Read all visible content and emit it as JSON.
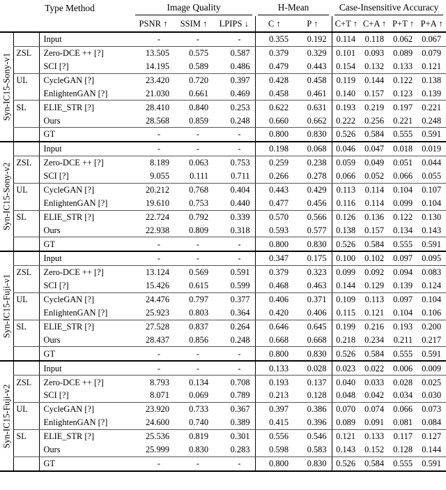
{
  "table": {
    "header": {
      "type_method": "Type Method",
      "groups": [
        {
          "label": "Image Quality",
          "span": 3
        },
        {
          "label": "H-Mean",
          "span": 2
        },
        {
          "label": "Case-Insensitive Accuracy",
          "span": 4
        }
      ],
      "columns": [
        "PSNR ↑",
        "SSIM ↑",
        "LPIPS ↓",
        "C ↑",
        "P ↑",
        "C+T ↑",
        "C+A ↑",
        "P+T ↑",
        "P+A ↑"
      ]
    },
    "blocks": [
      {
        "dataset": "Syn-IC15-Sony-v1",
        "rows": [
          {
            "type": "",
            "method": "Input",
            "bold": false,
            "values": [
              "-",
              "-",
              "-",
              "0.355",
              "0.192",
              "0.114",
              "0.118",
              "0.062",
              "0.067"
            ]
          },
          {
            "type": "ZSL",
            "method": "Zero-DCE ++ [?]",
            "bold": false,
            "values": [
              "13.505",
              "0.575",
              "0.587",
              "0.379",
              "0.329",
              "0.101",
              "0.093",
              "0.089",
              "0.079"
            ]
          },
          {
            "type": "",
            "method": "SCI [?]",
            "bold": false,
            "values": [
              "14.195",
              "0.589",
              "0.486",
              "0.479",
              "0.443",
              "0.154",
              "0.132",
              "0.133",
              "0.121"
            ]
          },
          {
            "type": "UL",
            "method": "CycleGAN [?]",
            "bold": false,
            "values": [
              "23.420",
              "0.720",
              "0.397",
              "0.428",
              "0.458",
              "0.119",
              "0.144",
              "0.122",
              "0.138"
            ]
          },
          {
            "type": "",
            "method": "EnlightenGAN [?]",
            "bold": false,
            "values": [
              "21.030",
              "0.661",
              "0.469",
              "0.458",
              "0.461",
              "0.140",
              "0.157",
              "0.123",
              "0.139"
            ]
          },
          {
            "type": "SL",
            "method": "ELIE_STR [?]",
            "bold": false,
            "values": [
              "28.410",
              "0.840",
              "0.253",
              "0.622",
              "0.631",
              "0.193",
              "0.219",
              "0.197",
              "0.221"
            ]
          },
          {
            "type": "",
            "method": "Ours",
            "bold": true,
            "values": [
              "28.568",
              "0.859",
              "0.248",
              "0.660",
              "0.662",
              "0.222",
              "0.256",
              "0.221",
              "0.248"
            ]
          },
          {
            "type": "",
            "method": "GT",
            "bold": false,
            "values": [
              "-",
              "-",
              "-",
              "0.800",
              "0.830",
              "0.526",
              "0.584",
              "0.555",
              "0.591"
            ]
          }
        ]
      },
      {
        "dataset": "Syn-IC15-Sony-v2",
        "rows": [
          {
            "type": "",
            "method": "Input",
            "bold": false,
            "values": [
              "-",
              "-",
              "-",
              "0.198",
              "0.068",
              "0.046",
              "0.047",
              "0.018",
              "0.019"
            ]
          },
          {
            "type": "ZSL",
            "method": "Zero-DCE ++ [?]",
            "bold": false,
            "values": [
              "8.189",
              "0.063",
              "0.753",
              "0.259",
              "0.238",
              "0.059",
              "0.049",
              "0.051",
              "0.044"
            ]
          },
          {
            "type": "",
            "method": "SCI [?]",
            "bold": false,
            "values": [
              "9.055",
              "0.111",
              "0.711",
              "0.266",
              "0.278",
              "0.066",
              "0.052",
              "0.066",
              "0.055"
            ]
          },
          {
            "type": "UL",
            "method": "CycleGAN [?]",
            "bold": false,
            "values": [
              "20.212",
              "0.768",
              "0.404",
              "0.443",
              "0.429",
              "0.113",
              "0.114",
              "0.104",
              "0.107"
            ]
          },
          {
            "type": "",
            "method": "EnlightenGAN [?]",
            "bold": false,
            "values": [
              "19.610",
              "0.753",
              "0.440",
              "0.477",
              "0.456",
              "0.116",
              "0.114",
              "0.099",
              "0.104"
            ]
          },
          {
            "type": "SL",
            "method": "ELIE_STR [?]",
            "bold": false,
            "values": [
              "22.724",
              "0.792",
              "0.339",
              "0.570",
              "0.566",
              "0.126",
              "0.136",
              "0.122",
              "0.130"
            ]
          },
          {
            "type": "",
            "method": "Ours",
            "bold": true,
            "values": [
              "22.938",
              "0.809",
              "0.318",
              "0.593",
              "0.577",
              "0.138",
              "0.157",
              "0.134",
              "0.143"
            ]
          },
          {
            "type": "",
            "method": "GT",
            "bold": false,
            "values": [
              "-",
              "-",
              "-",
              "0.800",
              "0.830",
              "0.526",
              "0.584",
              "0.555",
              "0.591"
            ]
          }
        ]
      },
      {
        "dataset": "Syn-IC15-Fuji-v1",
        "rows": [
          {
            "type": "",
            "method": "Input",
            "bold": false,
            "values": [
              "-",
              "-",
              "-",
              "0.347",
              "0.175",
              "0.100",
              "0.102",
              "0.097",
              "0.095"
            ]
          },
          {
            "type": "ZSL",
            "method": "Zero-DCE ++ [?]",
            "bold": false,
            "values": [
              "13.124",
              "0.569",
              "0.591",
              "0.379",
              "0.323",
              "0.099",
              "0.092",
              "0.094",
              "0.083"
            ]
          },
          {
            "type": "",
            "method": "SCI [?]",
            "bold": false,
            "values": [
              "15.426",
              "0.615",
              "0.599",
              "0.468",
              "0.463",
              "0.144",
              "0.129",
              "0.139",
              "0.124"
            ]
          },
          {
            "type": "UL",
            "method": "CycleGAN [?]",
            "bold": false,
            "values": [
              "24.476",
              "0.797",
              "0.377",
              "0.406",
              "0.371",
              "0.109",
              "0.113",
              "0.097",
              "0.104"
            ]
          },
          {
            "type": "",
            "method": "EnlightenGAN [?]",
            "bold": false,
            "values": [
              "25.923",
              "0.803",
              "0.364",
              "0.420",
              "0.406",
              "0.115",
              "0.121",
              "0.104",
              "0.106"
            ]
          },
          {
            "type": "SL",
            "method": "ELIE_STR [?]",
            "bold": false,
            "values": [
              "27.528",
              "0.837",
              "0.264",
              "0.646",
              "0.645",
              "0.199",
              "0.216",
              "0.193",
              "0.200"
            ]
          },
          {
            "type": "",
            "method": "Ours",
            "bold": true,
            "values": [
              "28.437",
              "0.856",
              "0.248",
              "0.668",
              "0.668",
              "0.218",
              "0.234",
              "0.211",
              "0.217"
            ]
          },
          {
            "type": "",
            "method": "GT",
            "bold": false,
            "values": [
              "-",
              "-",
              "-",
              "0.800",
              "0.830",
              "0.526",
              "0.584",
              "0.555",
              "0.591"
            ]
          }
        ]
      },
      {
        "dataset": "Syn-IC15-Fuji-v2",
        "rows": [
          {
            "type": "",
            "method": "Input",
            "bold": false,
            "values": [
              "-",
              "-",
              "-",
              "0.133",
              "0.028",
              "0.023",
              "0.022",
              "0.006",
              "0.009"
            ]
          },
          {
            "type": "ZSL",
            "method": "Zero-DCE ++ [?]",
            "bold": false,
            "values": [
              "8.793",
              "0.134",
              "0.708",
              "0.193",
              "0.137",
              "0.040",
              "0.033",
              "0.028",
              "0.025"
            ]
          },
          {
            "type": "",
            "method": "SCI [?]",
            "bold": false,
            "values": [
              "8.071",
              "0.069",
              "0.789",
              "0.213",
              "0.128",
              "0.048",
              "0.042",
              "0.034",
              "0.030"
            ]
          },
          {
            "type": "UL",
            "method": "CycleGAN [?]",
            "bold": false,
            "values": [
              "23.920",
              "0.733",
              "0.367",
              "0.397",
              "0.386",
              "0.070",
              "0.074",
              "0.066",
              "0.073"
            ]
          },
          {
            "type": "",
            "method": "EnlightenGAN [?]",
            "bold": false,
            "values": [
              "24.600",
              "0.740",
              "0.389",
              "0.415",
              "0.396",
              "0.089",
              "0.091",
              "0.081",
              "0.084"
            ]
          },
          {
            "type": "SL",
            "method": "ELIE_STR [?]",
            "bold": false,
            "values": [
              "25.536",
              "0.819",
              "0.301",
              "0.556",
              "0.546",
              "0.121",
              "0.133",
              "0.117",
              "0.127"
            ]
          },
          {
            "type": "",
            "method": "Ours",
            "bold": true,
            "values": [
              "25.999",
              "0.830",
              "0.283",
              "0.598",
              "0.583",
              "0.143",
              "0.152",
              "0.128",
              "0.144"
            ]
          },
          {
            "type": "",
            "method": "GT",
            "bold": false,
            "values": [
              "-",
              "-",
              "-",
              "0.800",
              "0.830",
              "0.526",
              "0.584",
              "0.555",
              "0.591"
            ]
          }
        ]
      }
    ]
  }
}
